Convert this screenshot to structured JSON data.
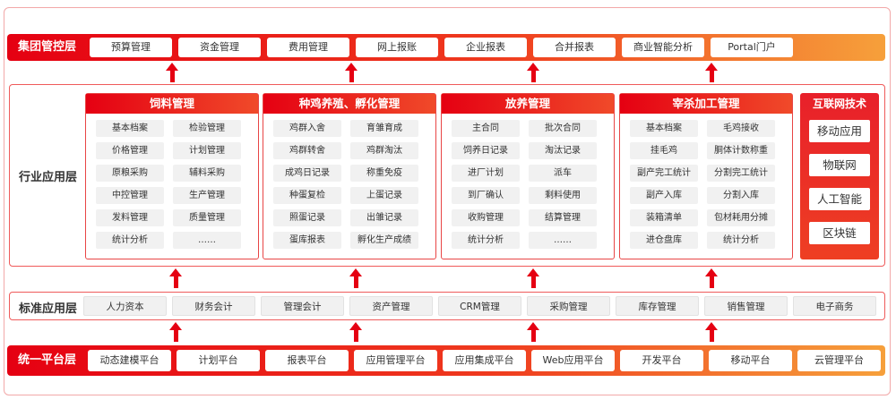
{
  "group_layer": {
    "title": "集团管控层",
    "items": [
      "预算管理",
      "资金管理",
      "费用管理",
      "网上报账",
      "企业报表",
      "合并报表",
      "商业智能分析",
      "Portal门户"
    ]
  },
  "industry_layer": {
    "title": "行业应用层",
    "modules": [
      {
        "title": "饲料管理",
        "items": [
          "基本档案",
          "检验管理",
          "价格管理",
          "计划管理",
          "原粮采购",
          "辅料采购",
          "中控管理",
          "生产管理",
          "发料管理",
          "质量管理",
          "统计分析",
          "……"
        ]
      },
      {
        "title": "种鸡养殖、孵化管理",
        "items": [
          "鸡群入舍",
          "育雏育成",
          "鸡群转舍",
          "鸡群淘汰",
          "成鸡日记录",
          "称重免疫",
          "种蛋复检",
          "上蛋记录",
          "照蛋记录",
          "出雏记录",
          "蛋库报表",
          "孵化生产成绩"
        ]
      },
      {
        "title": "放养管理",
        "items": [
          "主合同",
          "批次合同",
          "饲养日记录",
          "淘汰记录",
          "进厂计划",
          "派车",
          "到厂确认",
          "剩料使用",
          "收购管理",
          "结算管理",
          "统计分析",
          "……"
        ]
      },
      {
        "title": "宰杀加工管理",
        "items": [
          "基本档案",
          "毛鸡接收",
          "挂毛鸡",
          "胴体计数称重",
          "副产完工统计",
          "分割完工统计",
          "副产入库",
          "分割入库",
          "装箱清单",
          "包材耗用分摊",
          "进仓盘库",
          "统计分析"
        ]
      }
    ],
    "tech": {
      "title": "互联网技术",
      "items": [
        "移动应用",
        "物联网",
        "人工智能",
        "区块链"
      ]
    }
  },
  "standard_layer": {
    "title": "标准应用层",
    "items": [
      "人力资本",
      "财务会计",
      "管理会计",
      "资产管理",
      "CRM管理",
      "采购管理",
      "库存管理",
      "销售管理",
      "电子商务"
    ]
  },
  "platform_layer": {
    "title": "统一平台层",
    "items": [
      "动态建模平台",
      "计划平台",
      "报表平台",
      "应用管理平台",
      "应用集成平台",
      "Web应用平台",
      "开发平台",
      "移动平台",
      "云管理平台"
    ]
  }
}
